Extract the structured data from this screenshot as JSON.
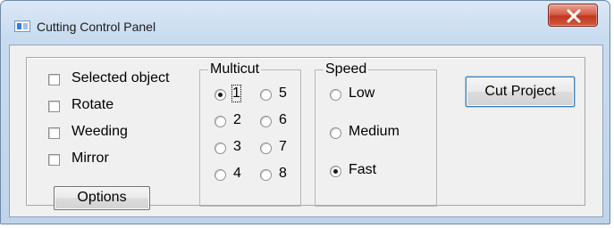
{
  "window": {
    "title": "Cutting Control Panel",
    "close_icon": "close-icon"
  },
  "options": {
    "selected_object": "Selected object",
    "rotate": "Rotate",
    "weeding": "Weeding",
    "mirror": "Mirror",
    "checked": {
      "selected_object": false,
      "rotate": false,
      "weeding": false,
      "mirror": false
    },
    "button_label": "Options"
  },
  "multicut": {
    "title": "Multicut",
    "items": [
      "1",
      "2",
      "3",
      "4",
      "5",
      "6",
      "7",
      "8"
    ],
    "selected": "1"
  },
  "speed": {
    "title": "Speed",
    "items": [
      "Low",
      "Medium",
      "Fast"
    ],
    "selected": "Fast"
  },
  "actions": {
    "cut_project": "Cut Project"
  },
  "colors": {
    "close_button": "#c7402a",
    "window_frame": "#bfd4ea",
    "dialog_face": "#f0f0f0"
  }
}
